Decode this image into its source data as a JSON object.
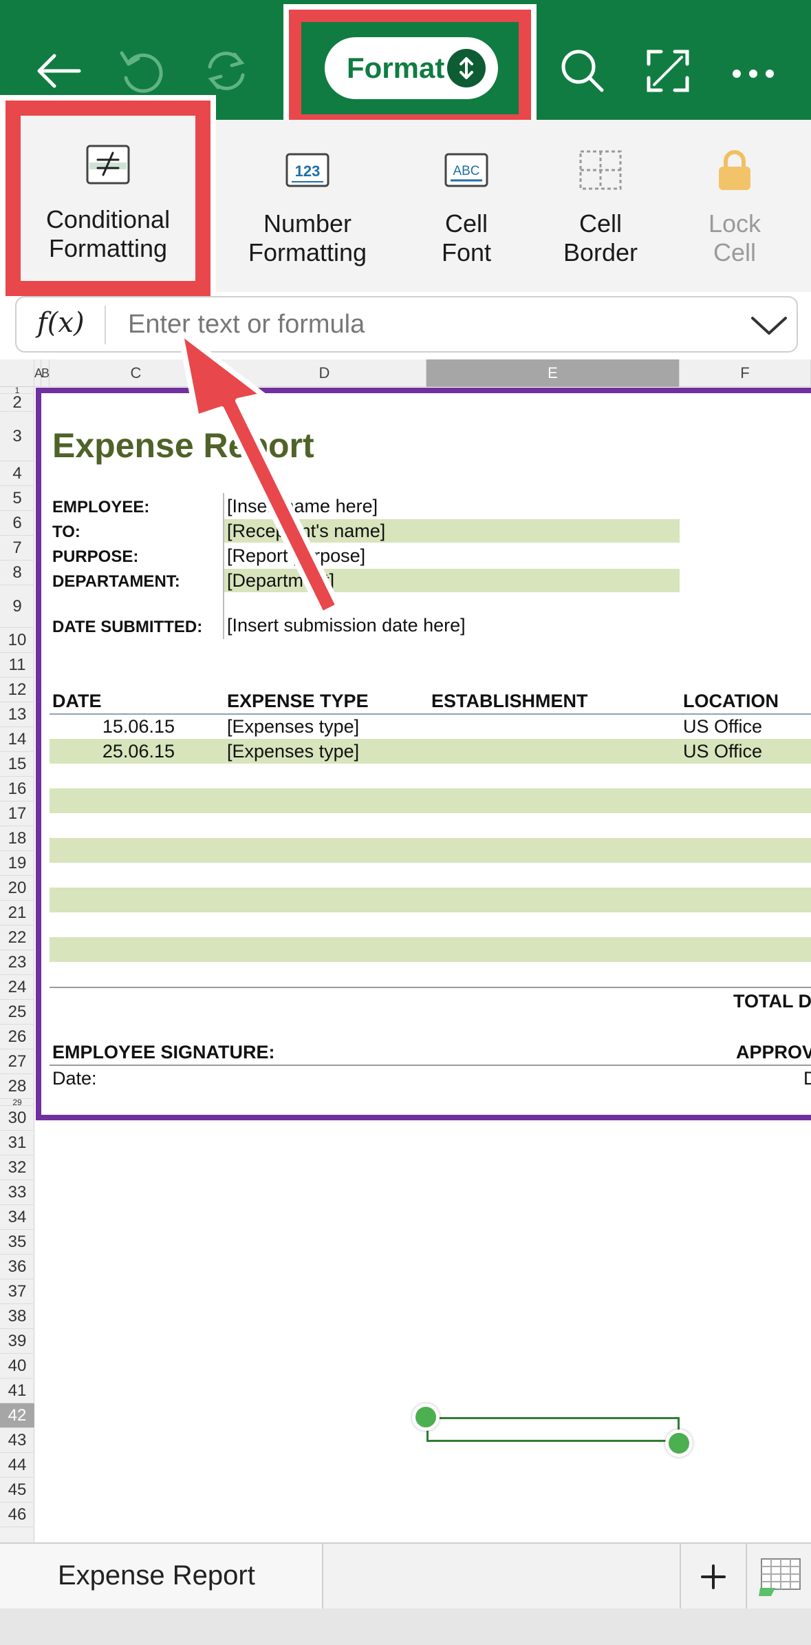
{
  "toolbar": {
    "format_label": "Format"
  },
  "ribbon": {
    "items": [
      {
        "line1": "Conditional",
        "line2": "Formatting"
      },
      {
        "line1": "Number",
        "line2": "Formatting"
      },
      {
        "line1": "Cell",
        "line2": "Font"
      },
      {
        "line1": "Cell",
        "line2": "Border"
      },
      {
        "line1": "Lock",
        "line2": "Cell"
      }
    ],
    "number_icon_text": "123",
    "font_icon_text": "ABC"
  },
  "formula_bar": {
    "fx_label": "f(x)",
    "placeholder": "Enter text or formula"
  },
  "columns": [
    "A",
    "B",
    "C",
    "D",
    "E",
    "F"
  ],
  "rows": [
    "1",
    "2",
    "3",
    "4",
    "5",
    "6",
    "7",
    "8",
    "9",
    "10",
    "11",
    "12",
    "13",
    "14",
    "15",
    "16",
    "17",
    "18",
    "19",
    "20",
    "21",
    "22",
    "23",
    "24",
    "25",
    "26",
    "27",
    "28",
    "29",
    "30",
    "31",
    "32",
    "33",
    "34",
    "35",
    "36",
    "37",
    "38",
    "39",
    "40",
    "41",
    "42",
    "43",
    "44",
    "45",
    "46"
  ],
  "sheet": {
    "title": "Expense Report",
    "employee_label": "EMPLOYEE:",
    "employee_value": "[Insert name here]",
    "to_label": "TO:",
    "to_value": "[Recepient's name]",
    "purpose_label": "PURPOSE:",
    "purpose_value": "[Report purpose]",
    "department_label": "DEPARTAMENT:",
    "department_value": "[Department]",
    "date_submitted_label": "DATE SUBMITTED:",
    "date_submitted_value": "[Insert submission date here]",
    "table_headers": [
      "DATE",
      "EXPENSE TYPE",
      "ESTABLISHMENT",
      "LOCATION"
    ],
    "table_rows": [
      {
        "date": "15.06.15",
        "type": "[Expenses type]",
        "establishment": "",
        "location": "US Office"
      },
      {
        "date": "25.06.15",
        "type": "[Expenses type]",
        "establishment": "",
        "location": "US Office"
      }
    ],
    "total_label": "TOTAL D",
    "signature_label": "EMPLOYEE SIGNATURE:",
    "approval_label": "APPROV",
    "date_label": "Date:",
    "date_label_right": "D"
  },
  "tabs": {
    "active": "Expense Report"
  },
  "colors": {
    "brand_green": "#107c41",
    "annotation_red": "#e8474c",
    "band_green": "#d8e4bc",
    "title_green": "#4f6228",
    "print_border": "#7030a0"
  }
}
